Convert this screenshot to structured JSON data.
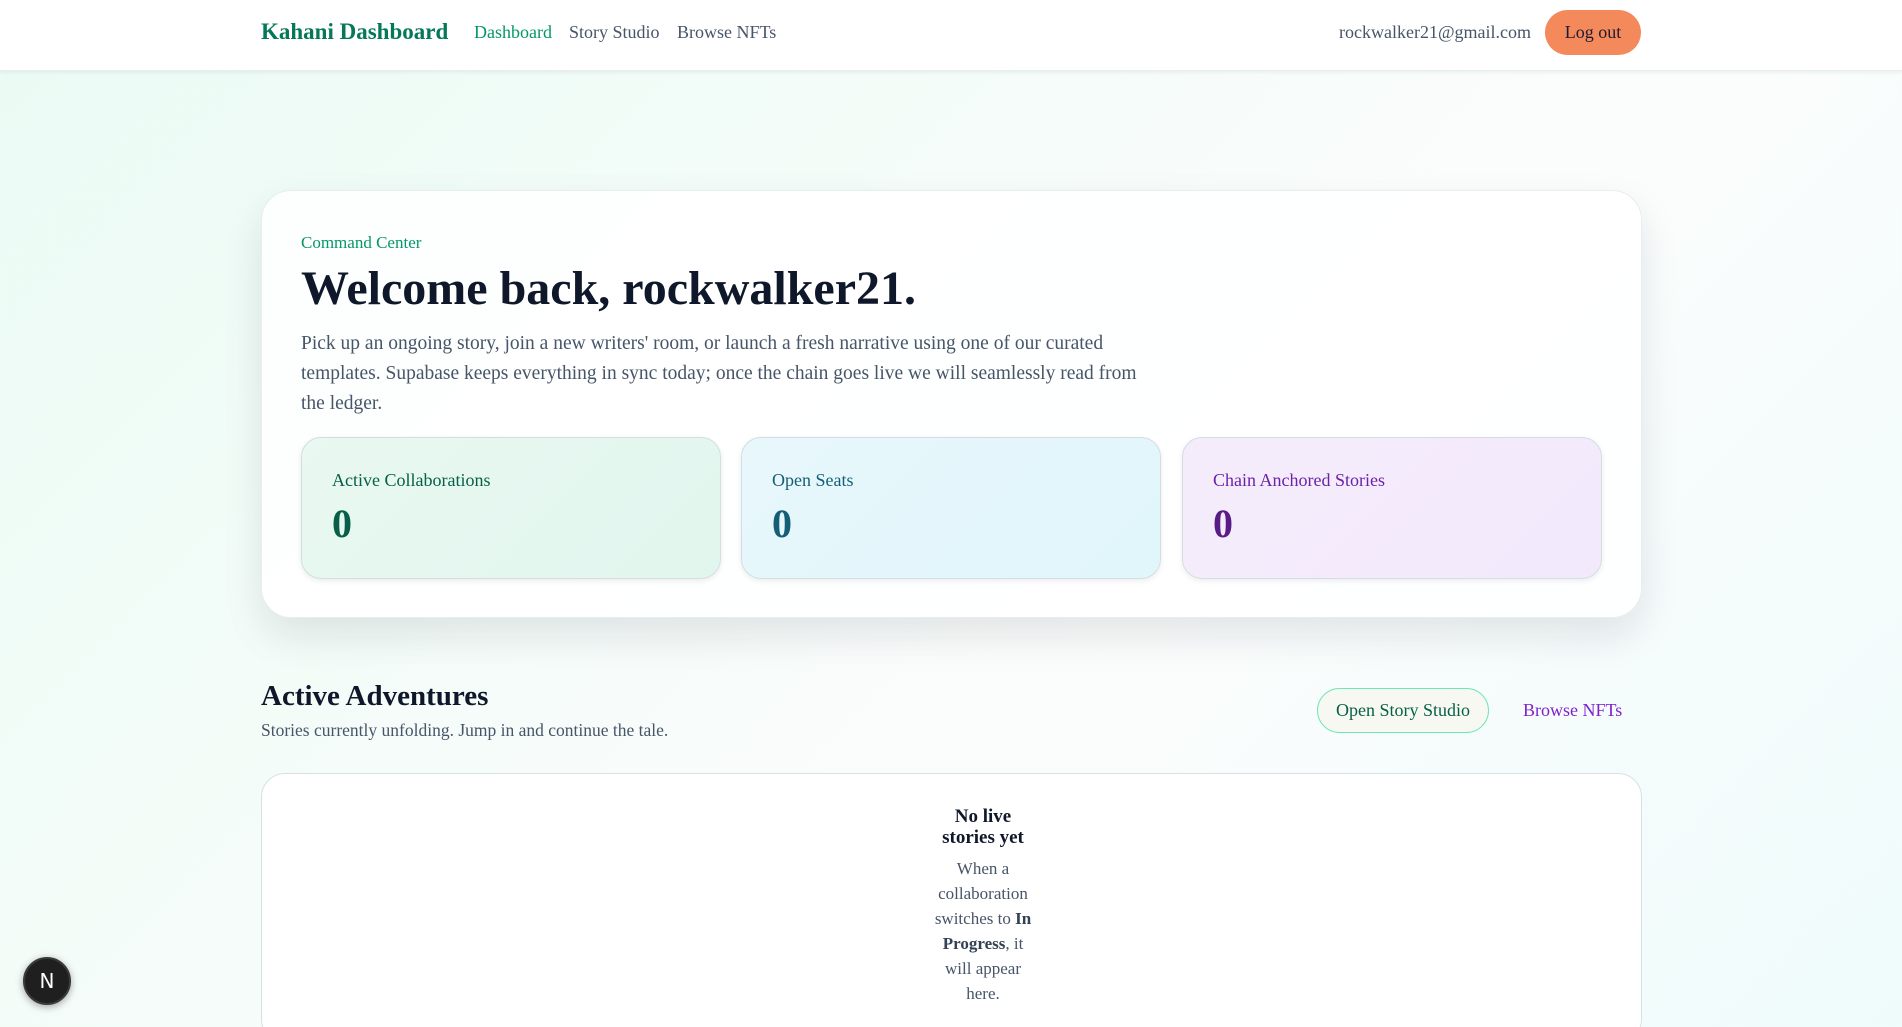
{
  "nav": {
    "brand": "Kahani Dashboard",
    "links": [
      "Dashboard",
      "Story Studio",
      "Browse NFTs"
    ],
    "email": "rockwalker21@gmail.com",
    "logout_label": "Log out"
  },
  "hero": {
    "eyebrow": "Command Center",
    "title": "Welcome back, rockwalker21.",
    "description": "Pick up an ongoing story, join a new writers' room, or launch a fresh narrative using one of our curated templates. Supabase keeps everything in sync today; once the chain goes live we will seamlessly read from the ledger.",
    "stats": [
      {
        "label": "Active Collaborations",
        "value": "0"
      },
      {
        "label": "Open Seats",
        "value": "0"
      },
      {
        "label": "Chain Anchored Stories",
        "value": "0"
      }
    ]
  },
  "section": {
    "title": "Active Adventures",
    "subtitle": "Stories currently unfolding. Jump in and continue the tale.",
    "studio_button": "Open Story Studio",
    "nft_link": "Browse NFTs"
  },
  "empty_state": {
    "title": "No live stories yet",
    "desc_before": "When a collaboration switches to",
    "desc_bold": "In Progress",
    "desc_after": ", it will appear here."
  },
  "badge": {
    "letter": "N"
  },
  "colors": {
    "accent_green": "#059669",
    "logout_orange": "#f4895c",
    "purple": "#7e22ce"
  }
}
